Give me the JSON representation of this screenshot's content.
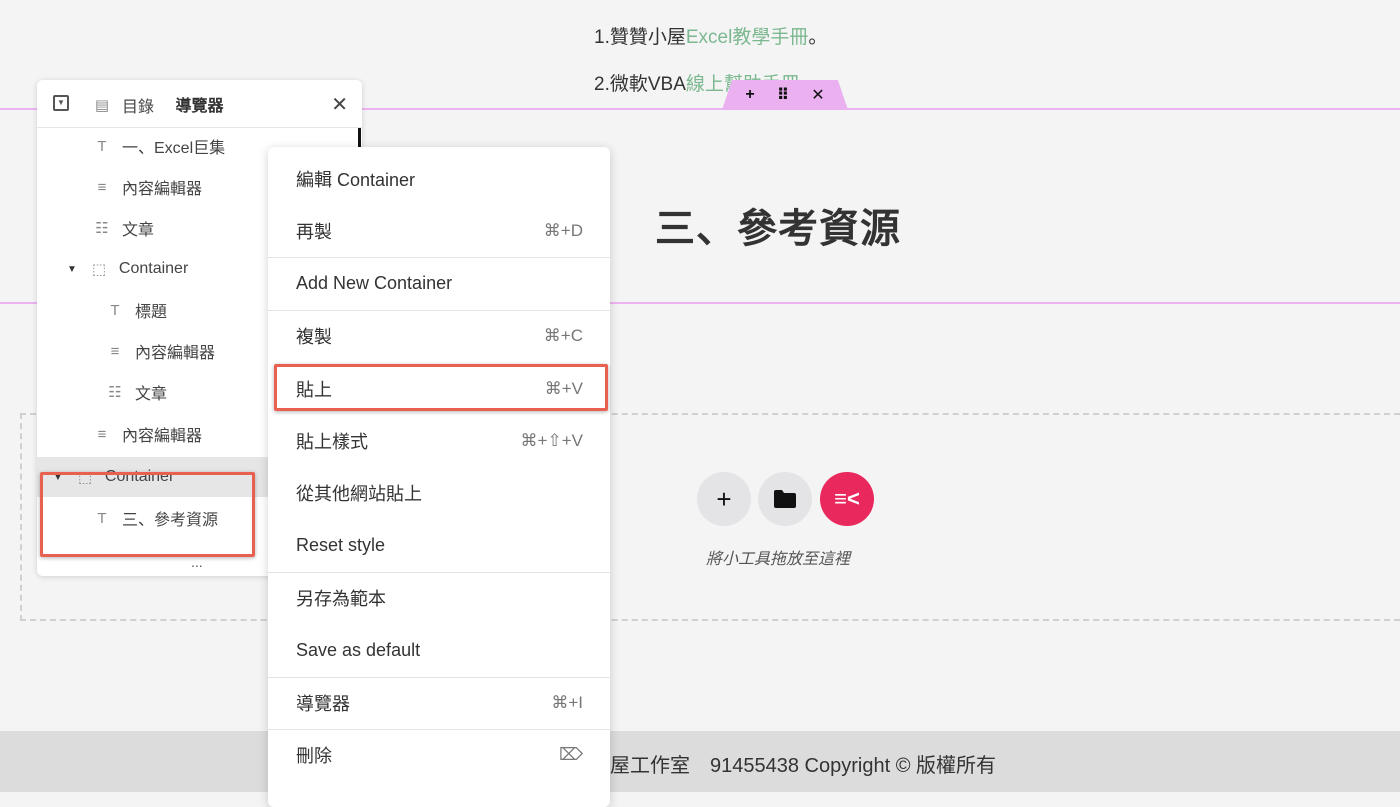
{
  "content": {
    "ref1": {
      "prefix": "1.贊贊小屋",
      "link": "Excel教學手冊",
      "suffix": "。"
    },
    "ref2": {
      "prefix": "2.微軟VBA",
      "link": "線上幫助手冊",
      "suffix": "。"
    },
    "container_toolbar": {
      "add": "+",
      "drag": "⠿",
      "close": "✕"
    },
    "heading": "三、參考資源",
    "drop_hint": "將小工具拖放至這裡",
    "footer": "屋工作室　91455438 Copyright © 版權所有",
    "accent_color": "#e9285e"
  },
  "navigator": {
    "title": "導覽器",
    "items": [
      {
        "label": "目錄",
        "icon": "toc-icon"
      },
      {
        "label": "一、Excel巨集",
        "icon": "heading-icon"
      },
      {
        "label": "內容編輯器",
        "icon": "text-editor-icon"
      },
      {
        "label": "文章",
        "icon": "posts-icon"
      },
      {
        "label": "Container",
        "icon": "container-icon"
      },
      {
        "label": "標題",
        "icon": "heading-icon"
      },
      {
        "label": "內容編輯器",
        "icon": "text-editor-icon"
      },
      {
        "label": "文章",
        "icon": "posts-icon"
      },
      {
        "label": "內容編輯器",
        "icon": "text-editor-icon"
      },
      {
        "label": "Container",
        "icon": "container-icon"
      },
      {
        "label": "三、參考資源",
        "icon": "heading-icon"
      }
    ],
    "more": "..."
  },
  "context_menu": {
    "items": [
      {
        "label": "編輯 Container",
        "shortcut": ""
      },
      {
        "label": "再製",
        "shortcut": "⌘+D"
      },
      {
        "label": "Add New Container",
        "shortcut": ""
      },
      {
        "label": "複製",
        "shortcut": "⌘+C"
      },
      {
        "label": "貼上",
        "shortcut": "⌘+V"
      },
      {
        "label": "貼上樣式",
        "shortcut": "⌘+⇧+V"
      },
      {
        "label": "從其他網站貼上",
        "shortcut": ""
      },
      {
        "label": "Reset style",
        "shortcut": ""
      },
      {
        "label": "另存為範本",
        "shortcut": ""
      },
      {
        "label": "Save as default",
        "shortcut": ""
      },
      {
        "label": "導覽器",
        "shortcut": "⌘+I"
      },
      {
        "label": "刪除",
        "shortcut": "⌦"
      }
    ]
  }
}
